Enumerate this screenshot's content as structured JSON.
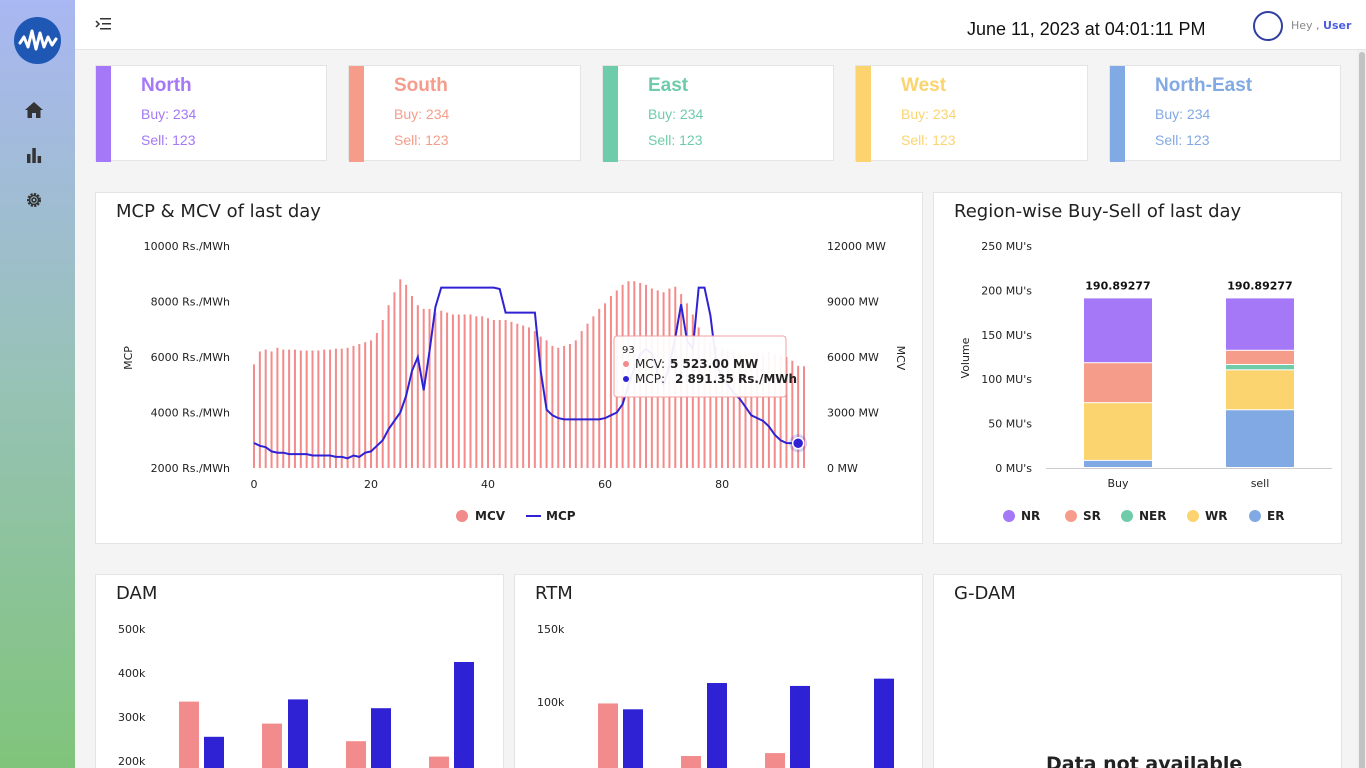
{
  "header": {
    "datetime": "June 11, 2023 at 04:01:11 PM",
    "greeting": "Hey ,",
    "user": "User"
  },
  "sidebar": {
    "items": [
      {
        "icon": "home-icon"
      },
      {
        "icon": "bar-chart-icon"
      },
      {
        "icon": "gear-icon"
      }
    ]
  },
  "regions": [
    {
      "name": "North",
      "buy": "Buy: 234",
      "sell": "Sell: 123",
      "color": "#a578f8"
    },
    {
      "name": "South",
      "buy": "Buy: 234",
      "sell": "Sell: 123",
      "color": "#f59d8a"
    },
    {
      "name": "East",
      "buy": "Buy: 234",
      "sell": "Sell: 123",
      "color": "#6fccab"
    },
    {
      "name": "West",
      "buy": "Buy: 234",
      "sell": "Sell: 123",
      "color": "#fbd470"
    },
    {
      "name": "North-East",
      "buy": "Buy: 234",
      "sell": "Sell: 123",
      "color": "#81a9e3"
    }
  ],
  "panels": {
    "mcp_title": "MCP & MCV of last day",
    "region_title": "Region-wise Buy-Sell of last day",
    "dam_title": "DAM",
    "rtm_title": "RTM",
    "gdam_title": "G-DAM",
    "gdam_message": "Data not available"
  },
  "chart_data": [
    {
      "type": "bar+line",
      "title": "MCP & MCV of last day",
      "ylabel_left": "MCP",
      "ylabel_right": "MCV",
      "left_ticks": [
        "2000 Rs./MWh",
        "4000 Rs./MWh",
        "6000 Rs./MWh",
        "8000 Rs./MWh",
        "10000 Rs./MWh"
      ],
      "right_ticks": [
        "0 MW",
        "3000 MW",
        "6000 MW",
        "9000 MW",
        "12000 MW"
      ],
      "x_ticks": [
        "0",
        "20",
        "40",
        "60",
        "80"
      ],
      "ylim_left": [
        2000,
        10000
      ],
      "ylim_right": [
        0,
        12000
      ],
      "series": [
        {
          "name": "MCV",
          "color": "#f28b8b",
          "values": [
            5600,
            6300,
            6400,
            6300,
            6500,
            6400,
            6400,
            6400,
            6350,
            6350,
            6350,
            6350,
            6400,
            6400,
            6450,
            6450,
            6500,
            6600,
            6700,
            6800,
            6900,
            7300,
            8000,
            8800,
            9500,
            10200,
            9900,
            9300,
            8800,
            8600,
            8600,
            8400,
            8500,
            8400,
            8300,
            8300,
            8300,
            8300,
            8200,
            8200,
            8100,
            8000,
            8000,
            8000,
            7900,
            7800,
            7700,
            7600,
            7400,
            7100,
            6900,
            6600,
            6500,
            6600,
            6700,
            6900,
            7400,
            7800,
            8200,
            8600,
            8900,
            9300,
            9600,
            9900,
            10100,
            10100,
            10000,
            9900,
            9700,
            9600,
            9500,
            9700,
            9800,
            9400,
            8900,
            8300,
            7600,
            7100,
            6800,
            6600,
            6500,
            6400,
            6300,
            6200,
            6100,
            6000,
            6100,
            6200,
            6300,
            6200,
            6100,
            6000,
            5800,
            5523,
            5500
          ],
          "axis": "right"
        },
        {
          "name": "MCP",
          "color": "#2e22d4",
          "values": [
            2900,
            2800,
            2750,
            2600,
            2550,
            2550,
            2500,
            2500,
            2500,
            2500,
            2450,
            2450,
            2450,
            2450,
            2400,
            2400,
            2350,
            2450,
            2400,
            2550,
            2600,
            2800,
            3000,
            3400,
            3700,
            4000,
            4600,
            5500,
            6000,
            4800,
            6200,
            7800,
            8500,
            8500,
            8500,
            8500,
            8500,
            8500,
            8500,
            8500,
            8500,
            8500,
            8450,
            7600,
            7600,
            7600,
            7600,
            7600,
            7600,
            5500,
            4100,
            3900,
            3800,
            3750,
            3750,
            3750,
            3750,
            3750,
            3750,
            3750,
            3800,
            3900,
            4000,
            4300,
            5000,
            5600,
            6100,
            6300,
            6100,
            5400,
            5000,
            5700,
            6700,
            7900,
            6600,
            6300,
            8500,
            8500,
            7500,
            5800,
            5200,
            5000,
            4700,
            4500,
            4200,
            3900,
            3800,
            3700,
            3500,
            3200,
            3000,
            2900,
            2891.35,
            2891.35
          ],
          "axis": "left"
        }
      ],
      "tooltip": {
        "index": "93",
        "mcv_label": "MCV:",
        "mcv_value": "5 523.00 MW",
        "mcp_label": "MCP:",
        "mcp_value": "2 891.35 Rs./MWh"
      },
      "legend": [
        "MCV",
        "MCP"
      ]
    },
    {
      "type": "bar",
      "stacked": true,
      "title": "Region-wise Buy-Sell of last day",
      "ylabel": "Volume",
      "categories": [
        "Buy",
        "sell"
      ],
      "totals": [
        "190.89277",
        "190.89277"
      ],
      "y_ticks": [
        "0 MU's",
        "50 MU's",
        "100 MU's",
        "150 MU's",
        "200 MU's",
        "250 MU's"
      ],
      "ylim": [
        0,
        250
      ],
      "series": [
        {
          "name": "ER",
          "color": "#81a9e3",
          "values": [
            8,
            65
          ]
        },
        {
          "name": "WR",
          "color": "#fbd470",
          "values": [
            65,
            45
          ]
        },
        {
          "name": "NER",
          "color": "#6fccab",
          "values": [
            0,
            6
          ]
        },
        {
          "name": "SR",
          "color": "#f59d8a",
          "values": [
            45,
            16
          ]
        },
        {
          "name": "NR",
          "color": "#a578f8",
          "values": [
            73,
            59
          ]
        }
      ],
      "legend": [
        "NR",
        "SR",
        "NER",
        "WR",
        "ER"
      ]
    },
    {
      "type": "bar",
      "title": "DAM",
      "y_ticks": [
        "200k",
        "300k",
        "400k",
        "500k"
      ],
      "ylim": [
        160000,
        500000
      ],
      "series": [
        {
          "color": "#f28b8b",
          "values": [
            335000,
            285000,
            245000,
            210000
          ]
        },
        {
          "color": "#2e22d4",
          "values": [
            255000,
            340000,
            320000,
            425000
          ]
        }
      ]
    },
    {
      "type": "bar",
      "title": "RTM",
      "y_ticks": [
        "100k",
        "150k"
      ],
      "ylim": [
        55000,
        150000
      ],
      "series": [
        {
          "color": "#f28b8b",
          "values": [
            99000,
            63000,
            65000
          ]
        },
        {
          "color": "#2e22d4",
          "values": [
            95000,
            113000,
            111000,
            116000
          ]
        }
      ]
    }
  ]
}
